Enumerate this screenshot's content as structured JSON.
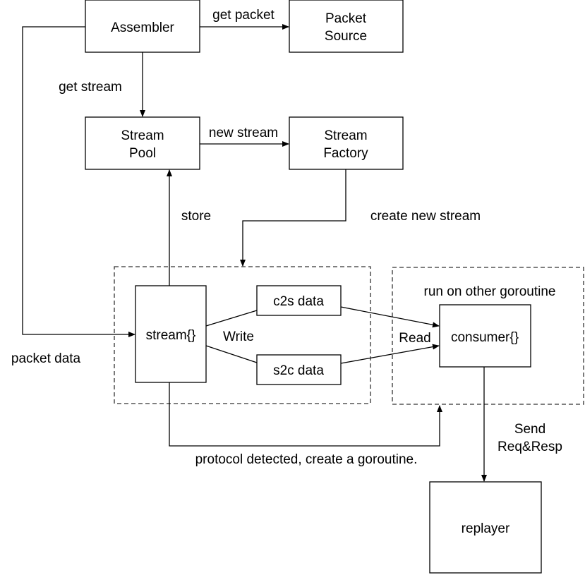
{
  "nodes": {
    "assembler": "Assembler",
    "packet_source": [
      "Packet",
      "Source"
    ],
    "stream_pool": [
      "Stream",
      "Pool"
    ],
    "stream_factory": [
      "Stream",
      "Factory"
    ],
    "stream": "stream{}",
    "c2s": "c2s data",
    "s2c": "s2c data",
    "consumer": "consumer{}",
    "replayer": "replayer"
  },
  "groups": {
    "consumer_group_label": "run on other goroutine"
  },
  "edges": {
    "get_packet": "get packet",
    "get_stream": "get stream",
    "new_stream": "new stream",
    "create_new_stream": "create new stream",
    "store": "store",
    "packet_data": "packet data",
    "write": "Write",
    "read": "Read",
    "protocol_detected": "protocol detected, create a goroutine.",
    "send": [
      "Send",
      "Req&Resp"
    ]
  }
}
